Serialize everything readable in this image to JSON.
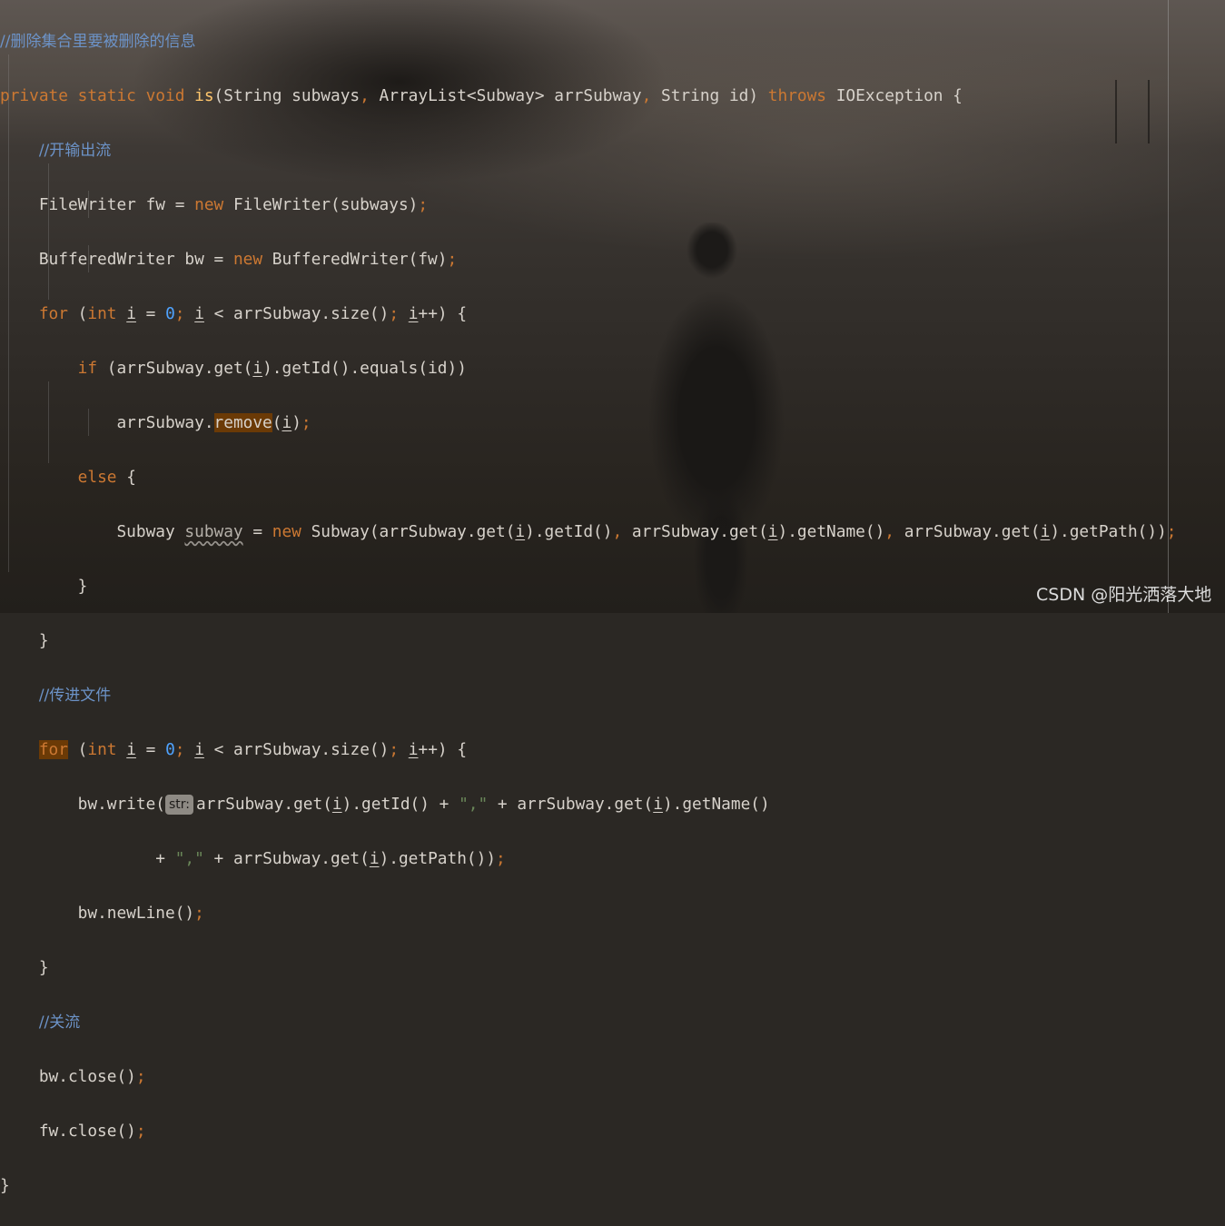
{
  "code": {
    "l1_comment": "//删除集合里要被删除的信息",
    "l2": {
      "kw1": "private static void ",
      "name": "is",
      "sig": "(String subways",
      "comma1": ",",
      "sig2": " ArrayList<Subway> arrSubway",
      "comma2": ",",
      "sig3": " String id) ",
      "throws": "throws",
      "rest": " IOException {"
    },
    "l3_comment": "//开输出流",
    "l4": {
      "a": "FileWriter fw = ",
      "new": "new",
      "b": " FileWriter(subways)",
      "semi": ";"
    },
    "l5": {
      "a": "BufferedWriter bw = ",
      "new": "new",
      "b": " BufferedWriter(fw)",
      "semi": ";"
    },
    "l6": {
      "for": "for",
      "a": " (",
      "int": "int",
      "i1": "i",
      "eq": " = ",
      "zero": "0",
      "semi1": ";",
      "i2": "i",
      "b": " < arrSubway.size()",
      "semi2": ";",
      "i3": "i",
      "c": "++) {"
    },
    "l7": {
      "if": "if",
      "a": " (arrSubway.get(",
      "i": "i",
      "b": ").getId().equals(id))"
    },
    "l8": {
      "a": "arrSubway.",
      "remove": "remove",
      "b": "(",
      "i": "i",
      "c": ")",
      "semi": ";"
    },
    "l9": {
      "else": "else",
      "b": " {"
    },
    "l10": {
      "a": "Subway ",
      "var": "subway",
      "b": " = ",
      "new": "new",
      "c": " Subway(arrSubway.get(",
      "i1": "i",
      "d": ").getId()",
      "comma1": ",",
      "e": " arrSubway.get(",
      "i2": "i",
      "f": ").getName()",
      "comma2": ",",
      "g": " arrSubway.get(",
      "i3": "i",
      "h": ").getPath())",
      "semi": ";"
    },
    "l11": "}",
    "l12": "}",
    "l13_comment": "//传进文件",
    "l14": {
      "for": "for",
      "a": " (",
      "int": "int",
      "i1": "i",
      "eq": " = ",
      "zero": "0",
      "semi1": ";",
      "i2": "i",
      "b": " < arrSubway.size()",
      "semi2": ";",
      "i3": "i",
      "c": "++) {"
    },
    "l15": {
      "a": "bw.write(",
      "hint": "str:",
      "b": "arrSubway.get(",
      "i1": "i",
      "c": ").getId() + ",
      "s": "\",\"",
      "d": " + arrSubway.get(",
      "i2": "i",
      "e": ").getName()"
    },
    "l16": {
      "a": "+ ",
      "s": "\",\"",
      "b": " + arrSubway.get(",
      "i": "i",
      "c": ").getPath())",
      "semi": ";"
    },
    "l17": {
      "a": "bw.newLine()",
      "semi": ";"
    },
    "l18": "}",
    "l19_comment": "//关流",
    "l20": {
      "a": "bw.close()",
      "semi": ";"
    },
    "l21": {
      "a": "fw.close()",
      "semi": ";"
    },
    "l22": "}"
  },
  "watermark": "CSDN @阳光洒落大地"
}
